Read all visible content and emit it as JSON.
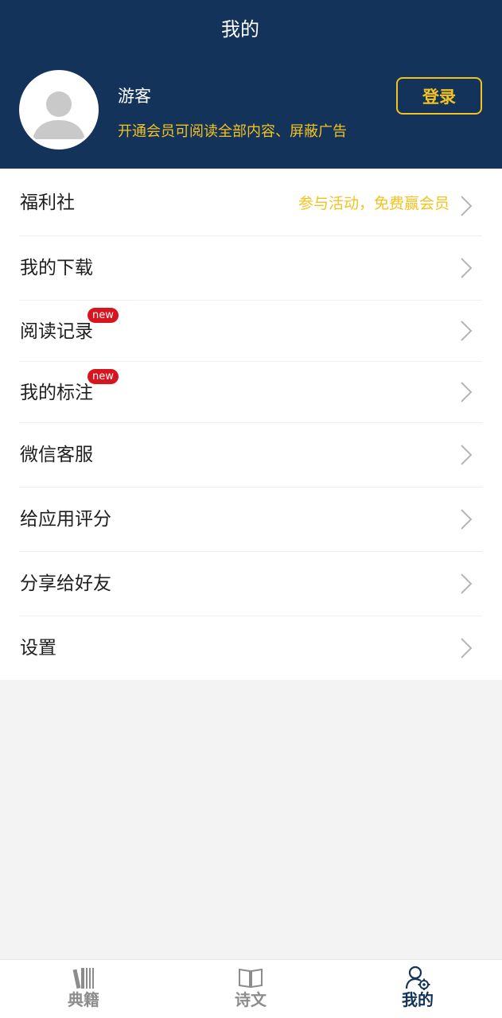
{
  "header": {
    "title": "我的",
    "username": "游客",
    "vip_tip": "开通会员可阅读全部内容、屏蔽广告",
    "login_label": "登录"
  },
  "menu": {
    "items": [
      {
        "label": "福利社",
        "extra": "参与活动，免费赢会员"
      },
      {
        "label": "我的下载"
      },
      {
        "label": "阅读记录",
        "badge": "new"
      },
      {
        "label": "我的标注",
        "badge": "new"
      },
      {
        "label": "微信客服"
      },
      {
        "label": "给应用评分"
      },
      {
        "label": "分享给好友"
      },
      {
        "label": "设置"
      }
    ]
  },
  "tabbar": {
    "tabs": [
      {
        "label": "典籍",
        "icon": "books-icon",
        "active": false
      },
      {
        "label": "诗文",
        "icon": "open-book-icon",
        "active": false
      },
      {
        "label": "我的",
        "icon": "user-settings-icon",
        "active": true
      }
    ]
  },
  "colors": {
    "header_bg": "#13335a",
    "accent_gold": "#f3c21e",
    "badge_red": "#d7151f",
    "tab_inactive": "#8c8c8c",
    "tab_active": "#13335a"
  }
}
